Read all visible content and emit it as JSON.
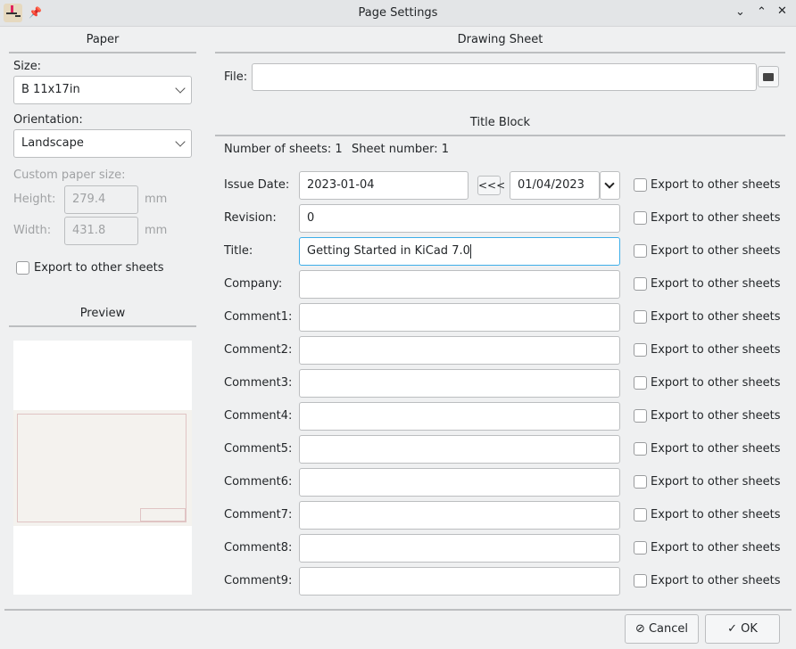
{
  "window": {
    "title": "Page Settings"
  },
  "paper": {
    "header": "Paper",
    "size_label": "Size:",
    "size_value": "B 11x17in",
    "orientation_label": "Orientation:",
    "orientation_value": "Landscape",
    "custom_label": "Custom paper size:",
    "height_label": "Height:",
    "height_value": "279.4",
    "width_label": "Width:",
    "width_value": "431.8",
    "unit": "mm",
    "export_label": "Export to other sheets",
    "preview_header": "Preview"
  },
  "drawing": {
    "header": "Drawing Sheet",
    "file_label": "File:",
    "file_value": ""
  },
  "titleblock": {
    "header": "Title Block",
    "num_sheets": "Number of sheets: 1",
    "sheet_number": "Sheet number: 1",
    "date_copy_button": "<<<",
    "date_picker_value": "01/04/2023",
    "export_label": "Export to other sheets",
    "fields": [
      {
        "label": "Issue Date:",
        "value": "2023-01-04"
      },
      {
        "label": "Revision:",
        "value": "0"
      },
      {
        "label": "Title:",
        "value": "Getting Started in KiCad 7.0"
      },
      {
        "label": "Company:",
        "value": ""
      },
      {
        "label": "Comment1:",
        "value": ""
      },
      {
        "label": "Comment2:",
        "value": ""
      },
      {
        "label": "Comment3:",
        "value": ""
      },
      {
        "label": "Comment4:",
        "value": ""
      },
      {
        "label": "Comment5:",
        "value": ""
      },
      {
        "label": "Comment6:",
        "value": ""
      },
      {
        "label": "Comment7:",
        "value": ""
      },
      {
        "label": "Comment8:",
        "value": ""
      },
      {
        "label": "Comment9:",
        "value": ""
      }
    ]
  },
  "buttons": {
    "cancel": "Cancel",
    "ok": "OK"
  },
  "colors": {
    "accent": "#3daee9",
    "sheet_border": "#c88a8a"
  }
}
